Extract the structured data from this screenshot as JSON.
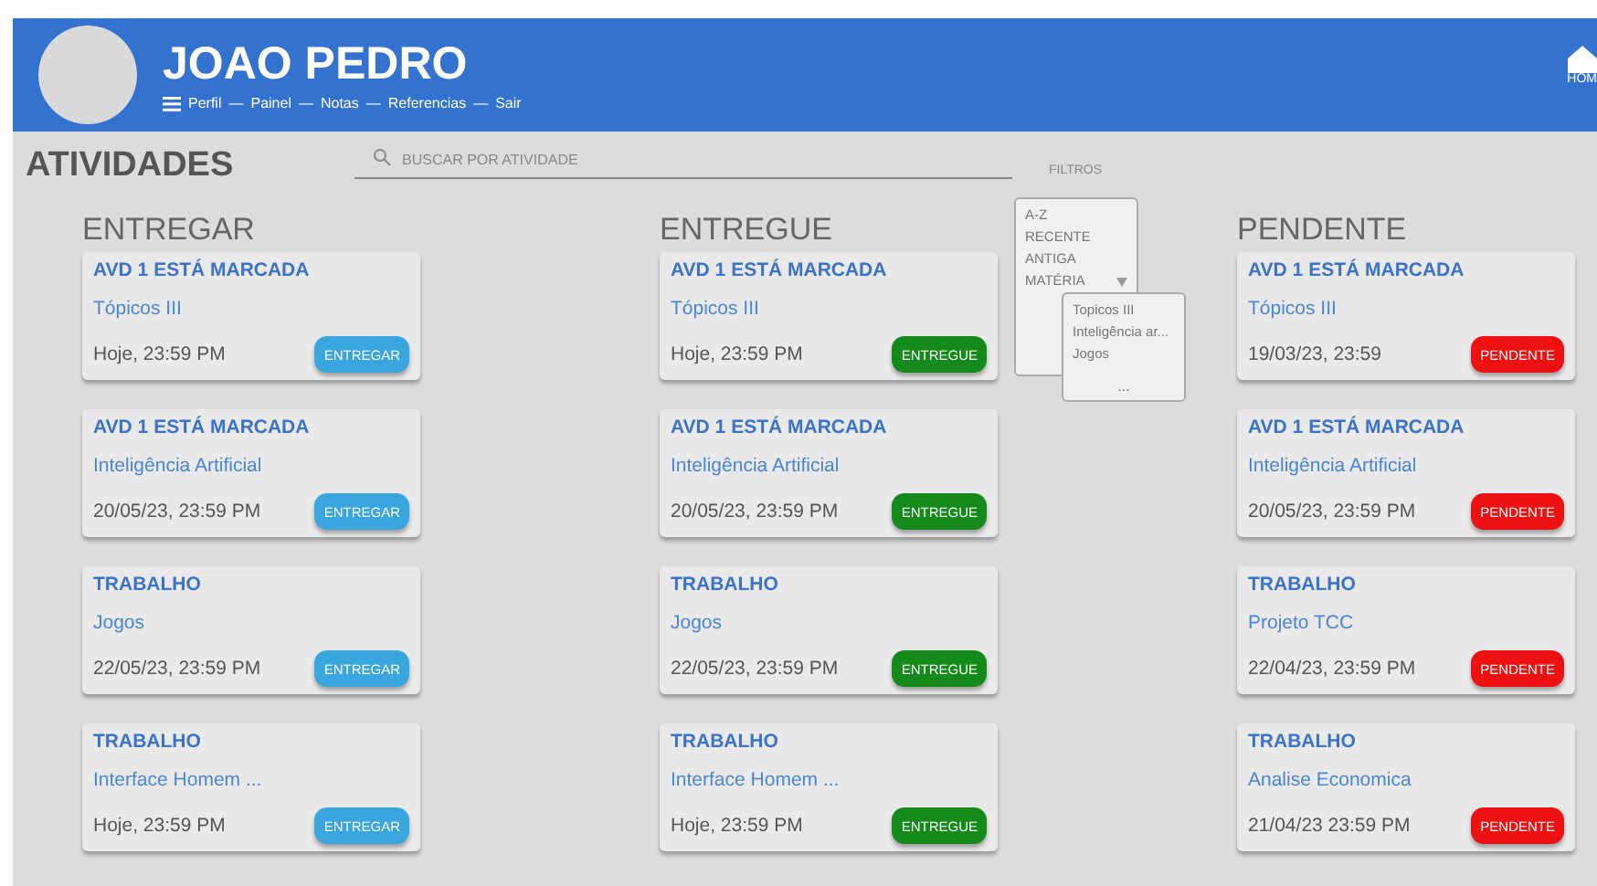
{
  "header": {
    "name": "JOAO PEDRO",
    "nav": [
      "Perfil",
      "Painel",
      "Notas",
      "Referencias",
      "Sair"
    ],
    "nav_separator": "—",
    "home_label": "HOM"
  },
  "page_title": "ATIVIDADES",
  "search": {
    "placeholder": "BUSCAR POR ATIVIDADE"
  },
  "filters": {
    "label": "FILTROS",
    "options": [
      "A-Z",
      "RECENTE",
      "ANTIGA",
      "MATÉRIA"
    ],
    "submenu": [
      "Topicos III",
      "Inteligência ar...",
      "Jogos"
    ],
    "more": "..."
  },
  "columns": [
    {
      "title": "ENTREGAR",
      "kind": "entregar",
      "cards": [
        {
          "type": "AVD 1 ESTÁ MARCADA",
          "subject": "Tópicos III",
          "date": "Hoje, 23:59 PM",
          "status": "ENTREGAR"
        },
        {
          "type": "AVD 1 ESTÁ MARCADA",
          "subject": "Inteligência Artificial",
          "date": "20/05/23, 23:59 PM",
          "status": "ENTREGAR"
        },
        {
          "type": "TRABALHO",
          "subject": "Jogos",
          "date": "22/05/23, 23:59 PM",
          "status": "ENTREGAR"
        },
        {
          "type": "TRABALHO",
          "subject": "Interface Homem ...",
          "date": "Hoje, 23:59 PM",
          "status": "ENTREGAR"
        }
      ]
    },
    {
      "title": "ENTREGUE",
      "kind": "entregue",
      "cards": [
        {
          "type": "AVD 1 ESTÁ MARCADA",
          "subject": "Tópicos III",
          "date": "Hoje, 23:59 PM",
          "status": "ENTREGUE"
        },
        {
          "type": "AVD 1 ESTÁ MARCADA",
          "subject": "Inteligência Artificial",
          "date": "20/05/23, 23:59 PM",
          "status": "ENTREGUE"
        },
        {
          "type": "TRABALHO",
          "subject": "Jogos",
          "date": "22/05/23, 23:59 PM",
          "status": "ENTREGUE"
        },
        {
          "type": "TRABALHO",
          "subject": "Interface Homem ...",
          "date": "Hoje, 23:59 PM",
          "status": "ENTREGUE"
        }
      ]
    },
    {
      "title": "PENDENTE",
      "kind": "pendente",
      "cards": [
        {
          "type": "AVD 1 ESTÁ MARCADA",
          "subject": "Tópicos III",
          "date": "19/03/23, 23:59",
          "status": "PENDENTE"
        },
        {
          "type": "AVD 1 ESTÁ MARCADA",
          "subject": "Inteligência Artificial",
          "date": "20/05/23, 23:59 PM",
          "status": "PENDENTE"
        },
        {
          "type": "TRABALHO",
          "subject": "Projeto TCC",
          "date": "22/04/23, 23:59 PM",
          "status": "PENDENTE"
        },
        {
          "type": "TRABALHO",
          "subject": "Analise Economica",
          "date": "21/04/23 23:59 PM",
          "status": "PENDENTE"
        }
      ]
    }
  ]
}
